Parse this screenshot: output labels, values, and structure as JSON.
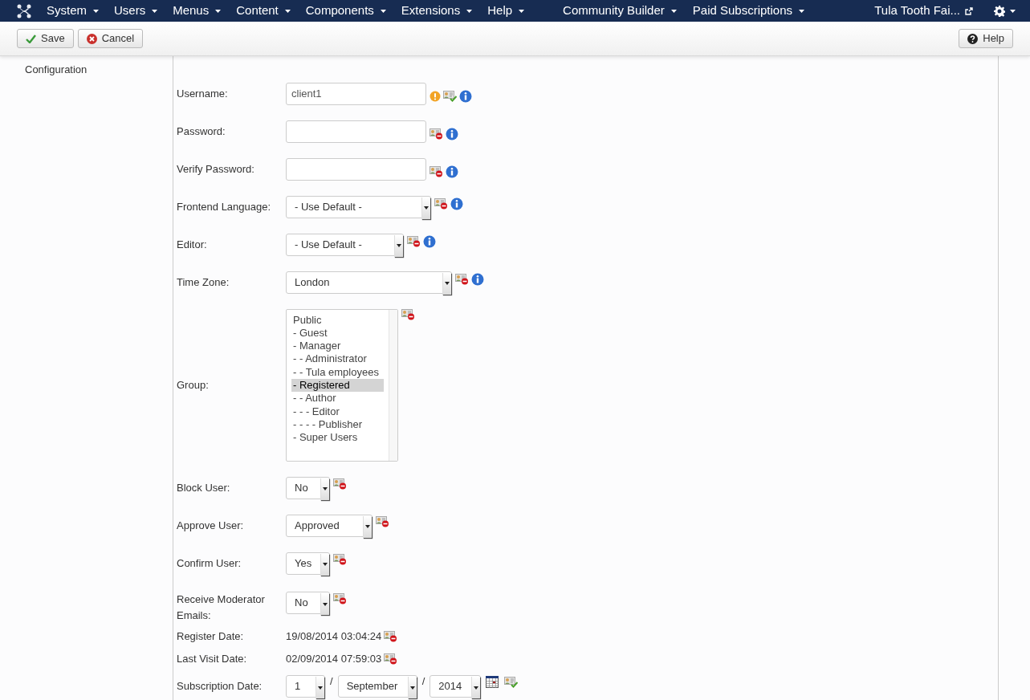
{
  "navbar": {
    "menus": [
      "System",
      "Users",
      "Menus",
      "Content",
      "Components",
      "Extensions",
      "Help",
      "Community Builder",
      "Paid Subscriptions"
    ],
    "site_link": "Tula Tooth Fai..."
  },
  "toolbar": {
    "buttons": [
      {
        "kind": "save",
        "label": "Save"
      },
      {
        "kind": "cancel",
        "label": "Cancel"
      },
      {
        "kind": "help",
        "label": "Help"
      }
    ]
  },
  "sidebar": {
    "items": [
      "Configuration"
    ]
  },
  "form": {
    "rows": [
      {
        "kind": "text",
        "label": "Username:",
        "value": "client1",
        "required": true,
        "profile_visible": true,
        "info": true
      },
      {
        "kind": "text",
        "label": "Password:",
        "value": "",
        "required": false,
        "profile_visible": false,
        "info": true
      },
      {
        "kind": "text",
        "label": "Verify Password:",
        "value": "",
        "required": false,
        "profile_visible": false,
        "info": true
      },
      {
        "kind": "select",
        "label": "Frontend Language:",
        "value": "- Use Default -",
        "required": false,
        "profile_visible": false,
        "info": true
      },
      {
        "kind": "select",
        "label": "Editor:",
        "value": "- Use Default -",
        "required": false,
        "profile_visible": false,
        "info": true
      },
      {
        "kind": "select",
        "label": "Time Zone:",
        "value": "London",
        "required": false,
        "profile_visible": false,
        "info": true
      },
      {
        "kind": "listbox",
        "label": "Group:",
        "options": [
          {
            "text": "Public",
            "selected": false
          },
          {
            "text": "- Guest",
            "selected": false
          },
          {
            "text": "- Manager",
            "selected": false
          },
          {
            "text": "- - Administrator",
            "selected": false
          },
          {
            "text": "- - Tula employees",
            "selected": false
          },
          {
            "text": "- Registered",
            "selected": true
          },
          {
            "text": "- - Author",
            "selected": false
          },
          {
            "text": "- - - Editor",
            "selected": false
          },
          {
            "text": "- - - - Publisher",
            "selected": false
          },
          {
            "text": "- Super Users",
            "selected": false
          }
        ],
        "required": false,
        "profile_visible": false,
        "info": false
      },
      {
        "kind": "select",
        "label": "Block User:",
        "value": "No",
        "required": false,
        "profile_visible": false,
        "info": false
      },
      {
        "kind": "select",
        "label": "Approve User:",
        "value": "Approved",
        "required": false,
        "profile_visible": false,
        "info": false
      },
      {
        "kind": "select",
        "label": "Confirm User:",
        "value": "Yes",
        "required": false,
        "profile_visible": false,
        "info": false
      },
      {
        "kind": "select",
        "label": "Receive Moderator Emails:",
        "value": "No",
        "required": false,
        "profile_visible": false,
        "info": false
      },
      {
        "kind": "static",
        "label": "Register Date:",
        "value": "19/08/2014 03:04:24",
        "required": false,
        "profile_visible": false,
        "info": false
      },
      {
        "kind": "static",
        "label": "Last Visit Date:",
        "value": "02/09/2014 07:59:03",
        "required": false,
        "profile_visible": false,
        "info": false
      },
      {
        "kind": "date",
        "label": "Subscription Date:",
        "parts": [
          "1",
          "September",
          "2014"
        ],
        "separators": [
          "/",
          "/"
        ],
        "required": false,
        "profile_visible": true,
        "info": false
      }
    ]
  }
}
